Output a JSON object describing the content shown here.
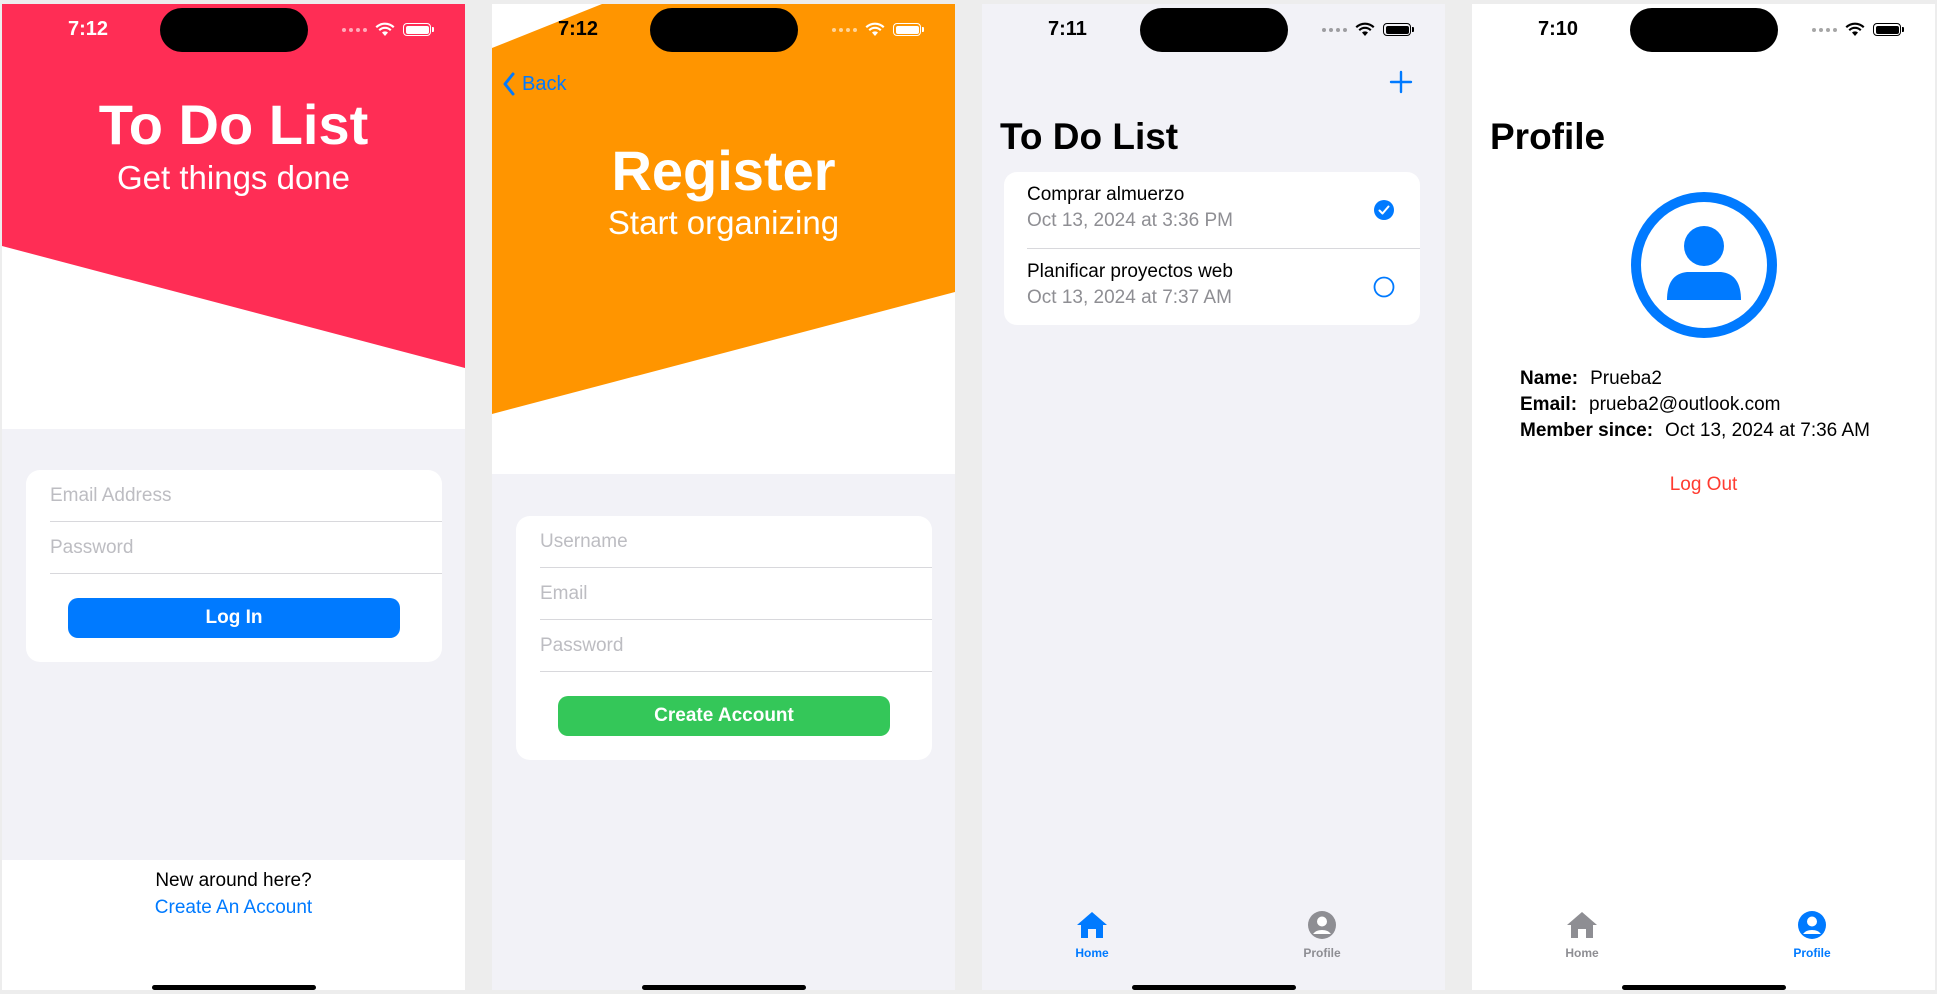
{
  "screens": {
    "login": {
      "time": "7:12",
      "title": "To Do List",
      "subtitle": "Get things done",
      "email_placeholder": "Email Address",
      "password_placeholder": "Password",
      "login_button": "Log In",
      "new_here": "New around here?",
      "create_account_link": "Create An Account",
      "banner_color": "#ff2d55"
    },
    "register": {
      "time": "7:12",
      "back_label": "Back",
      "title": "Register",
      "subtitle": "Start organizing",
      "username_placeholder": "Username",
      "email_placeholder": "Email",
      "password_placeholder": "Password",
      "create_button": "Create Account",
      "banner_color": "#ff9500",
      "button_color": "#34c759"
    },
    "todo": {
      "time": "7:11",
      "title": "To Do List",
      "add_icon": "plus-icon",
      "items": [
        {
          "title": "Comprar almuerzo",
          "date": "Oct 13, 2024 at 3:36 PM",
          "done": true
        },
        {
          "title": "Planificar proyectos web",
          "date": "Oct 13, 2024 at 7:37 AM",
          "done": false
        }
      ],
      "tabs": [
        {
          "label": "Home",
          "icon": "house-icon",
          "active": true
        },
        {
          "label": "Profile",
          "icon": "person-circle-icon",
          "active": false
        }
      ]
    },
    "profile": {
      "time": "7:10",
      "title": "Profile",
      "name_label": "Name:",
      "name_value": "Prueba2",
      "email_label": "Email:",
      "email_value": "prueba2@outlook.com",
      "member_label": "Member since:",
      "member_value": "Oct 13, 2024 at 7:36 AM",
      "logout": "Log Out",
      "tabs": [
        {
          "label": "Home",
          "icon": "house-icon",
          "active": false
        },
        {
          "label": "Profile",
          "icon": "person-circle-icon",
          "active": true
        }
      ]
    }
  },
  "colors": {
    "accent": "#007aff",
    "inactive_tab": "#8e8e93",
    "destructive": "#ff3b30"
  }
}
